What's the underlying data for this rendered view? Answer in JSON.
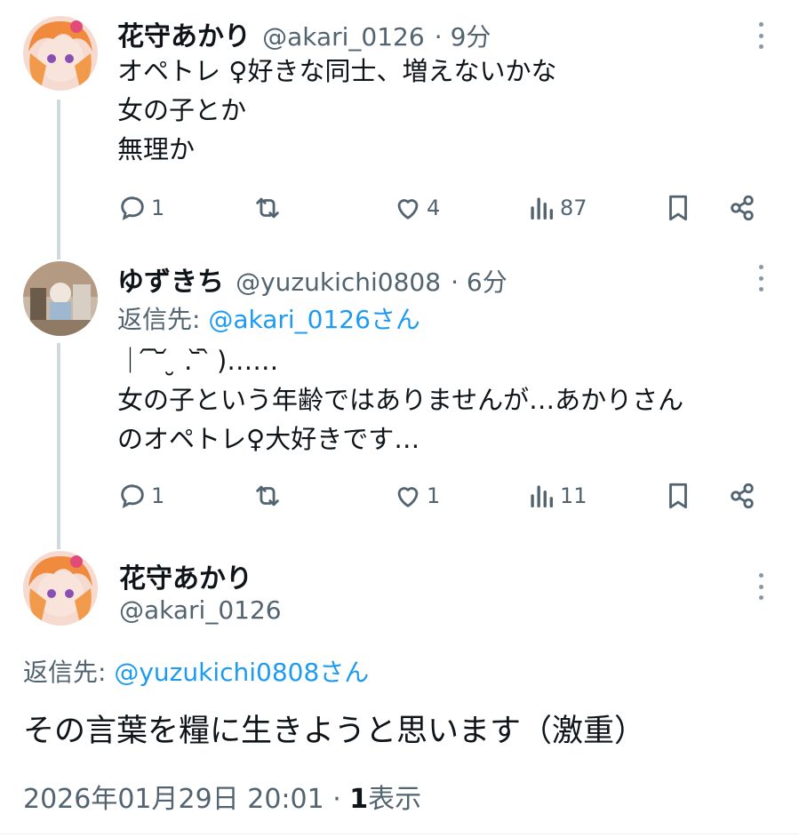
{
  "tweets": [
    {
      "name": "花守あかり",
      "handle": "@akari_0126",
      "time": "· 9分",
      "text": "オペトレ ♀好きな同士、増えないかな\n女の子とか\n無理か",
      "stats": {
        "reply": "1",
        "retweet": "",
        "like": "4",
        "views": "87"
      }
    },
    {
      "name": "ゆずきち",
      "handle": "@yuzukichi0808",
      "time": "· 6分",
      "reply_label": "返信先: ",
      "reply_target": "@akari_0126さん",
      "text": "｜ ᷇ ᷆ ᷄ ̮ . ᷅ ᷆ )……\n女の子という年齢ではありませんが…あかりさん\nのオペトレ♀大好きです…",
      "stats": {
        "reply": "1",
        "retweet": "",
        "like": "1",
        "views": "11"
      }
    }
  ],
  "main_tweet": {
    "name": "花守あかり",
    "handle": "@akari_0126",
    "reply_label": "返信先: ",
    "reply_target": "@yuzukichi0808さん",
    "text": "その言葉を糧に生きようと思います（激重）",
    "timestamp": "2026年01月29日 20:01 · ",
    "views_count": "1",
    "views_label": "表示"
  },
  "colors": {
    "accent": "#1d9bf0",
    "muted": "#536471",
    "line": "#cfd9de"
  }
}
